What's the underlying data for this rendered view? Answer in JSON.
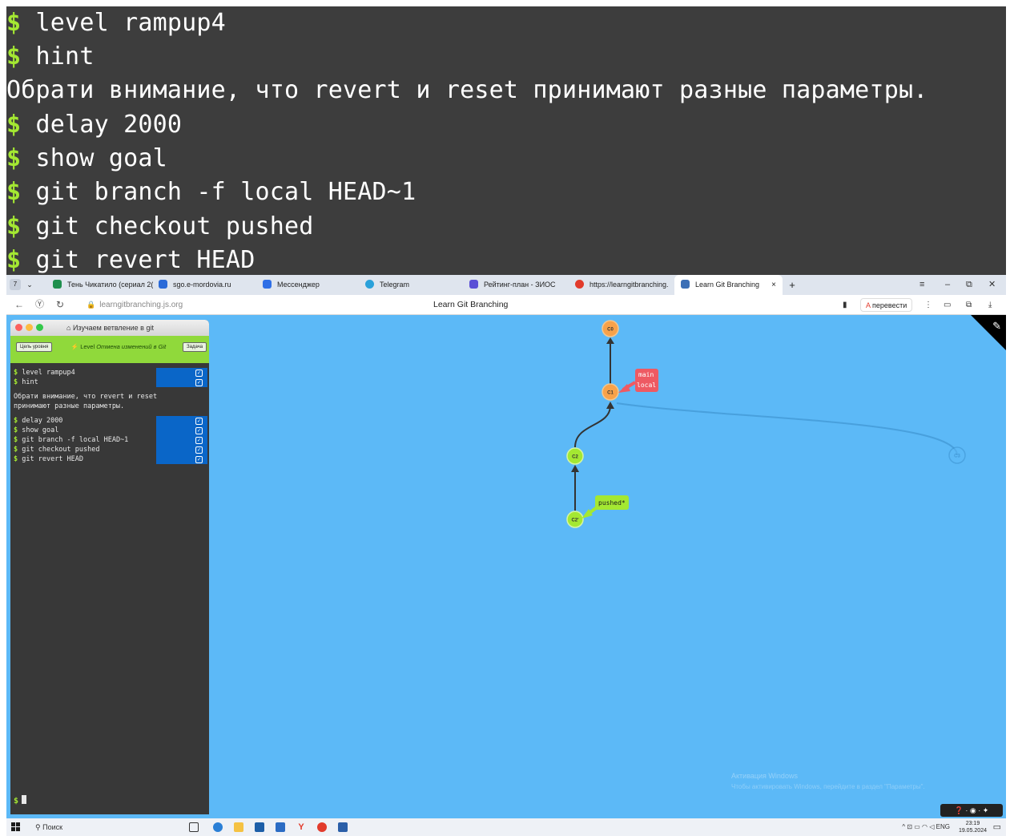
{
  "big_terminal": {
    "prompt": "$",
    "lines": [
      {
        "kind": "cmd",
        "text": "level rampup4"
      },
      {
        "kind": "cmd",
        "text": "hint"
      },
      {
        "kind": "out",
        "text": "Обрати внимание, что revert и reset принимают разные параметры."
      },
      {
        "kind": "cmd",
        "text": "delay 2000"
      },
      {
        "kind": "cmd",
        "text": "show goal"
      },
      {
        "kind": "cmd",
        "text": "git branch -f local HEAD~1"
      },
      {
        "kind": "cmd",
        "text": "git checkout pushed"
      },
      {
        "kind": "cmd",
        "text": "git revert HEAD"
      }
    ]
  },
  "browser": {
    "tab_counter": "7",
    "tabs": [
      {
        "label": "Тень Чикатило (сериал 2(",
        "color": "#1f8f4e"
      },
      {
        "label": "sgo.e-mordovia.ru",
        "color": "#2a6ad8"
      },
      {
        "label": "Мессенджер",
        "color": "#2f6fe6"
      },
      {
        "label": "Telegram",
        "color": "#2aa1da"
      },
      {
        "label": "Рейтинг-план - ЗИОС",
        "color": "#5a4fd6"
      },
      {
        "label": "https://learngitbranching.",
        "color": "#e23b2c"
      },
      {
        "label": "Learn Git Branching",
        "color": "#3b6fb6"
      }
    ],
    "active_tab_close": "×",
    "new_tab": "+",
    "url": "learngitbranching.js.org",
    "page_title": "Learn Git Branching",
    "translate_label": "перевести"
  },
  "panel": {
    "title": "Изучаем ветвление в git",
    "goal_button": "Цель уровня",
    "task_button": "Задача",
    "level_prefix": "Level",
    "level_name": "Отмена изменений в Git",
    "commands_group1": [
      "level rampup4",
      "hint"
    ],
    "hint_text": "Обрати внимание, что revert и reset принимают разные параметры.",
    "commands_group2": [
      "delay 2000",
      "show goal",
      "git branch -f local HEAD~1",
      "git checkout pushed",
      "git revert HEAD"
    ],
    "prompt": "$"
  },
  "graph": {
    "commits": [
      {
        "id": "C0",
        "color": "#f8a24a"
      },
      {
        "id": "C1",
        "color": "#f8a24a"
      },
      {
        "id": "C2",
        "color": "#a4e832"
      },
      {
        "id": "C2'",
        "color": "#a4e832"
      },
      {
        "id": "C3",
        "color": "#5cb9f7"
      }
    ],
    "branches": [
      {
        "name": "main",
        "color": "#ee5a63"
      },
      {
        "name": "local",
        "color": "#ee5a63"
      },
      {
        "name": "pushed*",
        "color": "#a4e832"
      }
    ]
  },
  "watermark": {
    "line1": "Активация Windows",
    "line2": "Чтобы активировать Windows, перейдите в раздел \"Параметры\"."
  },
  "taskbar": {
    "search_placeholder": "Поиск",
    "lang": "ENG",
    "time": "23:19",
    "date": "19.05.2024"
  }
}
